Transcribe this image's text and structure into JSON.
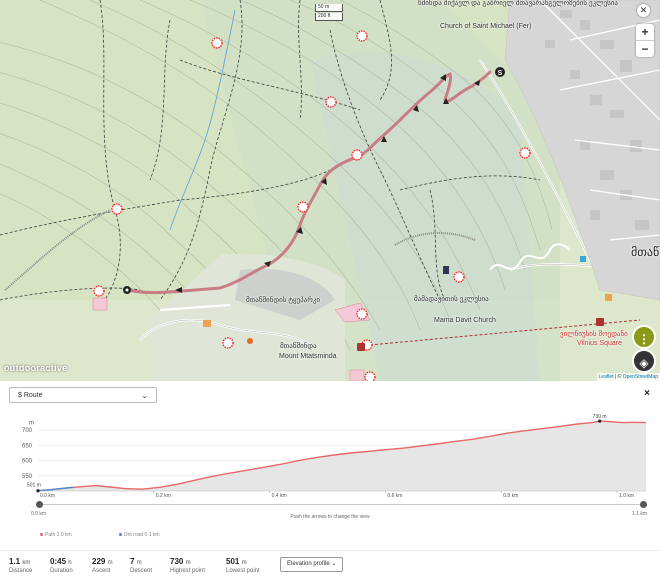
{
  "map": {
    "scale": {
      "metric": "50 m",
      "imperial": "200 ft"
    },
    "zoom": {
      "in": "+",
      "out": "−"
    },
    "brand": "outdooractive",
    "attribution": {
      "leaflet": "Leaflet",
      "sep": " | © ",
      "osm": "OpenStreetMap"
    },
    "labels": {
      "church_ka": "წმინდა მიქაელ და გაბრიელ მთავარანგელოზების ეკლესია",
      "church_en": "Church of Saint Michael (Fer)",
      "mtatsminda_park": "მთაწმინდის ტყეპარკი",
      "mtatsminda": "მთაწმინდა",
      "mount_mtatsminda": "Mount Mtatsminda",
      "mama_daviti_ka": "მამადავითის ეკლესია",
      "mama_daviti_en": "Mama Davit Church",
      "vilnius_ka": "ვილნიუსის მოედანი",
      "vilnius_en": "Vilnius Square",
      "big_right": "მთაწ"
    }
  },
  "panel": {
    "route_select": "Route",
    "close_icon": "×",
    "chart_data": {
      "type": "area",
      "title": "",
      "xlabel": "",
      "ylabel": "m",
      "ylim": [
        500,
        750
      ],
      "y_ticks": [
        "550",
        "600",
        "650",
        "700"
      ],
      "y_ticks_values": [
        550,
        600,
        650,
        700
      ],
      "ylabel_unit": "m",
      "x_ticks": [
        "0.0 km",
        "0.2 km",
        "0.4 km",
        "0.6 km",
        "0.8 km",
        "1.0 km"
      ],
      "x_ticks_values": [
        0.0,
        0.2,
        0.4,
        0.6,
        0.8,
        1.0
      ],
      "xlim": [
        0.0,
        1.05
      ],
      "start_label": "501 m",
      "peak_label": "730 m",
      "peak_x": 0.97,
      "series": [
        {
          "name": "Path",
          "color": "#e8676b",
          "x": [
            0.0,
            0.02,
            0.05,
            0.08,
            0.1,
            0.12,
            0.15,
            0.18,
            0.21,
            0.24,
            0.27,
            0.3,
            0.33,
            0.36,
            0.39,
            0.42,
            0.45,
            0.48,
            0.51,
            0.54,
            0.57,
            0.6,
            0.63,
            0.66,
            0.69,
            0.72,
            0.75,
            0.78,
            0.81,
            0.84,
            0.87,
            0.9,
            0.93,
            0.96,
            0.97,
            0.99,
            1.01,
            1.03,
            1.05
          ],
          "y": [
            501,
            504,
            510,
            515,
            518,
            514,
            508,
            506,
            512,
            522,
            535,
            548,
            558,
            568,
            578,
            588,
            600,
            610,
            618,
            625,
            630,
            636,
            641,
            648,
            655,
            663,
            670,
            680,
            690,
            698,
            705,
            712,
            720,
            726,
            730,
            728,
            725,
            726,
            725
          ]
        },
        {
          "name": "Dirt road",
          "color": "#4a82d4",
          "x": [
            0.0,
            0.02,
            0.05,
            0.06
          ],
          "y": [
            501,
            504,
            510,
            512
          ]
        }
      ]
    },
    "slider": {
      "start": "0.0 km",
      "end": "1.1 km",
      "start_value": 0.0,
      "end_value": 1.1,
      "hint": "Push the arrows to change the view"
    },
    "legend": [
      {
        "label": "Path 1.0 km",
        "color": "#e8676b"
      },
      {
        "label": "Dirt road 0.1 km",
        "color": "#4a82d4"
      }
    ],
    "stats": [
      {
        "value": "1.1",
        "unit": "km",
        "label": "Distance"
      },
      {
        "value": "0:45",
        "unit": "h",
        "label": "Duration"
      },
      {
        "value": "229",
        "unit": "m",
        "label": "Ascent"
      },
      {
        "value": "7",
        "unit": "m",
        "label": "Descent"
      },
      {
        "value": "730",
        "unit": "m",
        "label": "Highest point"
      },
      {
        "value": "501",
        "unit": "m",
        "label": "Lowest point"
      }
    ],
    "elevation_button": "Elevation profile"
  }
}
